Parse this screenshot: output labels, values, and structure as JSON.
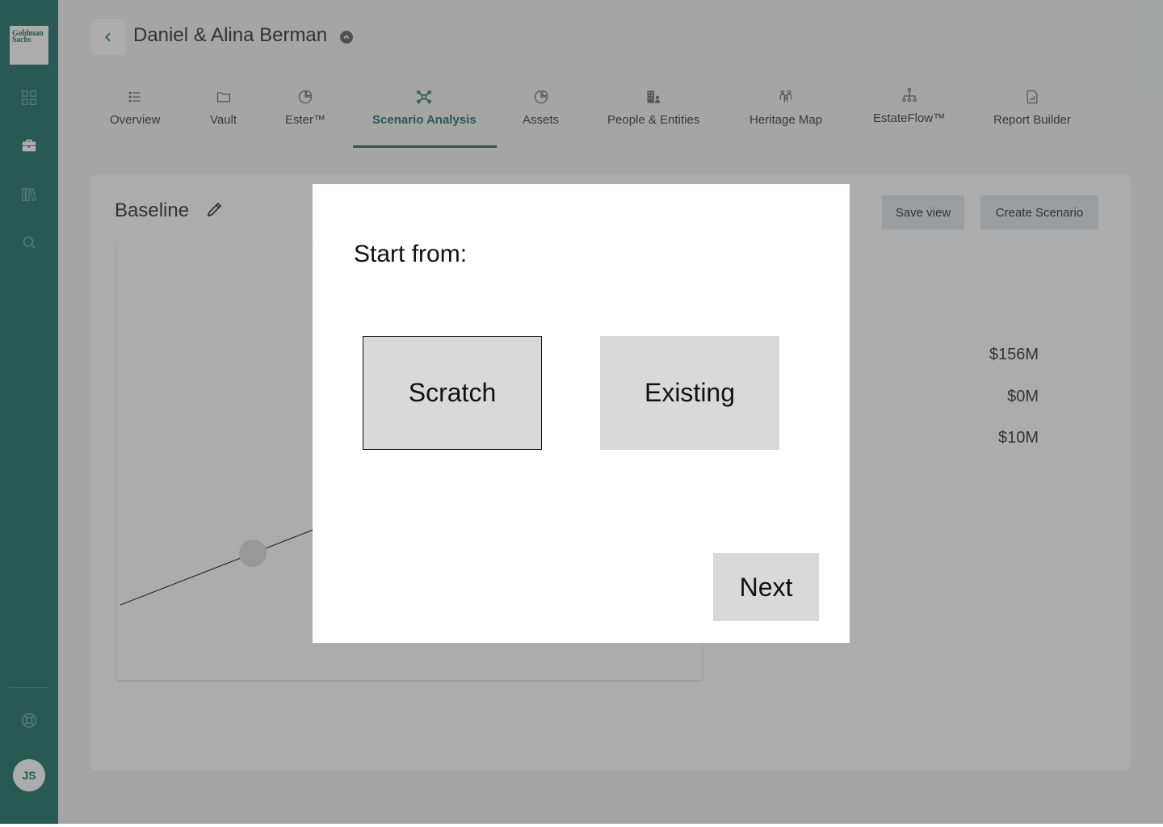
{
  "sidebar": {
    "logo_line1": "Goldman",
    "logo_line2": "Sachs",
    "icons": [
      "grid-icon",
      "briefcase-icon",
      "library-icon",
      "search-icon"
    ],
    "help_icon": "lifebuoy-icon",
    "avatar_initials": "JS"
  },
  "header": {
    "client_name": "Daniel & Alina Berman"
  },
  "tabs": [
    {
      "label": "Overview",
      "icon": "list-icon"
    },
    {
      "label": "Vault",
      "icon": "folder-icon"
    },
    {
      "label": "Ester™",
      "icon": "pie-icon"
    },
    {
      "label": "Scenario Analysis",
      "icon": "network-icon",
      "active": true
    },
    {
      "label": "Assets",
      "icon": "pie-icon"
    },
    {
      "label": "People & Entities",
      "icon": "buildings-icon"
    },
    {
      "label": "Heritage Map",
      "icon": "family-icon"
    },
    {
      "label": "EstateFlow™",
      "icon": "org-chart-icon"
    },
    {
      "label": "Report Builder",
      "icon": "document-icon"
    }
  ],
  "main": {
    "title": "Baseline",
    "save_view_label": "Save view",
    "create_scenario_label": "Create Scenario",
    "summary_values": [
      "$156M",
      "$0M",
      "$10M"
    ]
  },
  "modal": {
    "title": "Start from:",
    "options": [
      {
        "label": "Scratch",
        "selected": true
      },
      {
        "label": "Existing",
        "selected": false
      }
    ],
    "next_label": "Next"
  },
  "colors": {
    "brand": "#0d6a5b",
    "option_bg": "#d9d9d9"
  }
}
